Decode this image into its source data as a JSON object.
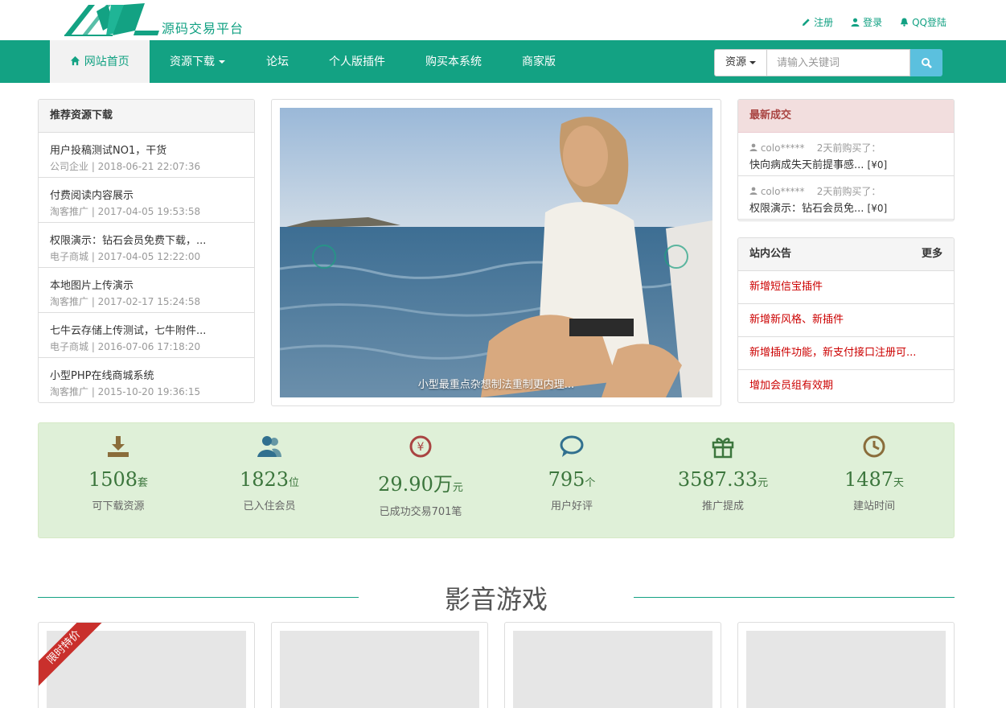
{
  "header": {
    "logo_text": "源码交易平台",
    "links": [
      {
        "icon": "pencil-icon",
        "label": "注册"
      },
      {
        "icon": "user-icon",
        "label": "登录"
      },
      {
        "icon": "bell-icon",
        "label": "QQ登陆"
      }
    ]
  },
  "nav": {
    "items": [
      {
        "label": "网站首页",
        "icon": "home-icon",
        "active": true
      },
      {
        "label": "资源下载",
        "dropdown": true
      },
      {
        "label": "论坛"
      },
      {
        "label": "个人版插件"
      },
      {
        "label": "购买本系统"
      },
      {
        "label": "商家版"
      }
    ],
    "search": {
      "type_label": "资源",
      "placeholder": "请输入关键词",
      "button_icon": "search-icon"
    }
  },
  "recommend": {
    "title": "推荐资源下载",
    "items": [
      {
        "title": "用户投稿测试NO1，干货",
        "meta": "公司企业 | 2018-06-21 22:07:36"
      },
      {
        "title": "付费阅读内容展示",
        "meta": "淘客推广 | 2017-04-05 19:53:58"
      },
      {
        "title": "权限演示：钻石会员免费下载，...",
        "meta": "电子商城 | 2017-04-05 12:22:00"
      },
      {
        "title": "本地图片上传演示",
        "meta": "淘客推广 | 2017-02-17 15:24:58"
      },
      {
        "title": "七牛云存储上传测试，七牛附件...",
        "meta": "电子商城 | 2016-07-06 17:18:20"
      },
      {
        "title": "小型PHP在线商城系统",
        "meta": "淘客推广 | 2015-10-20 19:36:15"
      }
    ]
  },
  "slider": {
    "caption": "小型最重点杂想制法重制更内理..."
  },
  "transactions": {
    "title": "最新成交",
    "items": [
      {
        "user": "colo*****",
        "time": "2天前购买了：",
        "item": "快向病成失天前提事感...",
        "price": "[¥0]"
      },
      {
        "user": "colo*****",
        "time": "2天前购买了：",
        "item": "权限演示：钻石会员免...",
        "price": "[¥0]"
      }
    ]
  },
  "notice": {
    "title": "站内公告",
    "more": "更多",
    "items": [
      "新增短信宝插件",
      "新增新风格、新插件",
      "新增插件功能，新支付接口注册可...",
      "增加会员组有效期"
    ]
  },
  "stats": [
    {
      "icon": "download-icon",
      "value": "1508",
      "unit": "套",
      "label": "可下载资源",
      "color": "#8a6d3b"
    },
    {
      "icon": "users-icon",
      "value": "1823",
      "unit": "位",
      "label": "已入住会员",
      "color": "#31708f"
    },
    {
      "icon": "yen-icon",
      "value": "29.90万",
      "unit": "元",
      "label": "已成功交易701笔",
      "color": "#a94442"
    },
    {
      "icon": "comment-icon",
      "value": "795",
      "unit": "个",
      "label": "用户好评",
      "color": "#31708f"
    },
    {
      "icon": "gift-icon",
      "value": "3587.33",
      "unit": "元",
      "label": "推广提成",
      "color": "#3c763d"
    },
    {
      "icon": "clock-icon",
      "value": "1487",
      "unit": "天",
      "label": "建站时间",
      "color": "#8a6d3b"
    }
  ],
  "section": {
    "title": "影音游戏",
    "ribbon": "限时特价"
  },
  "colors": {
    "brand": "#13a283",
    "search_btn": "#5bc0de"
  }
}
